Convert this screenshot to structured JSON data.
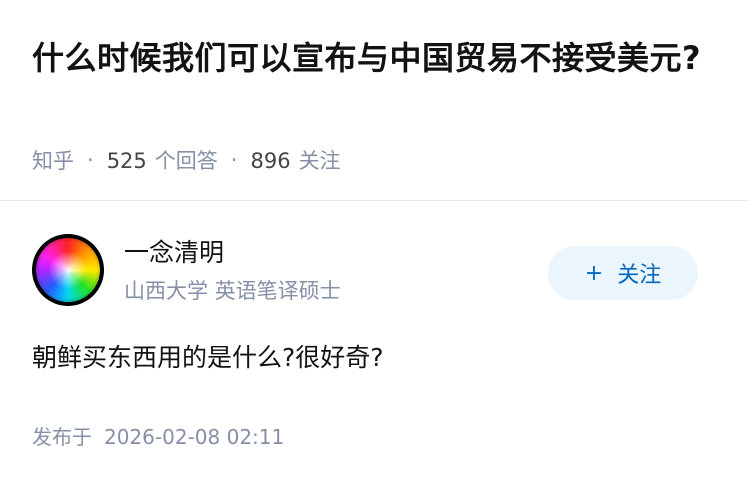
{
  "question": {
    "title": "什么时候我们可以宣布与中国贸易不接受美元?",
    "source": "知乎",
    "answer_count": "525",
    "answer_label": "个回答",
    "follower_count": "896",
    "follower_label": "关注"
  },
  "author": {
    "name": "一念清明",
    "headline": "山西大学 英语笔译硕士",
    "avatar_icon": "rainbow-orb-avatar",
    "follow_button_label": "关注",
    "follow_button_icon": "+"
  },
  "answer": {
    "content": "朝鲜买东西用的是什么?很好奇?",
    "published_label": "发布于",
    "published_time": "2026-02-08 02:11"
  },
  "colors": {
    "title": "#121212",
    "meta": "#8590a6",
    "follow_bg": "#ebf5fd",
    "follow_text": "#0066bf"
  }
}
